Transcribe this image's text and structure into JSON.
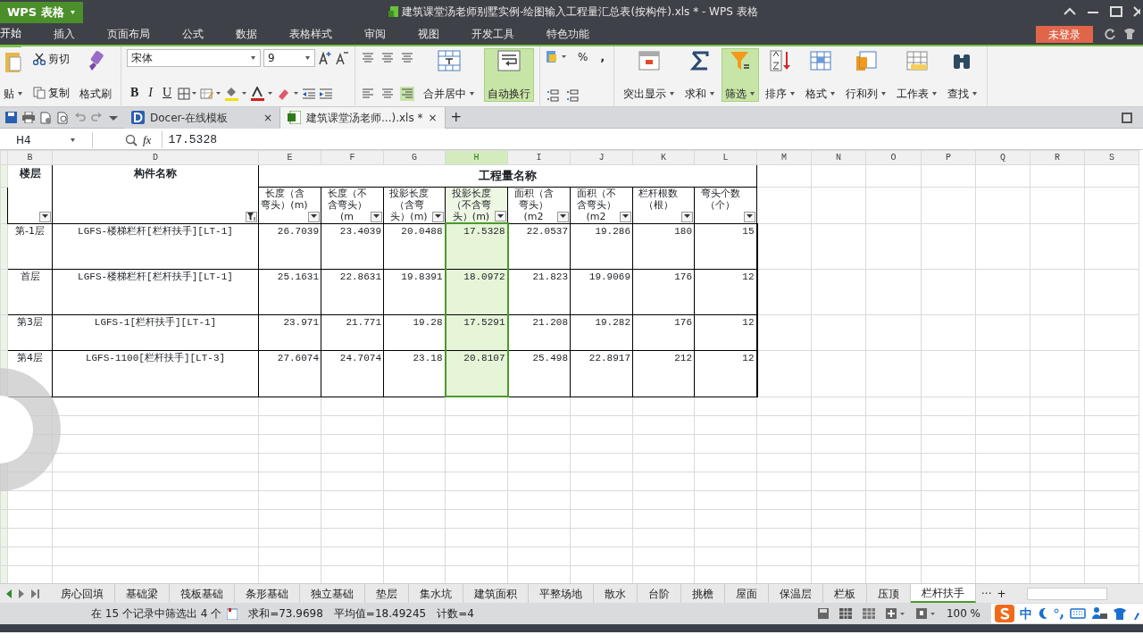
{
  "title_bar": {
    "app_menu": "WPS 表格",
    "title": "建筑课堂汤老师别墅实例-绘图输入工程量汇总表(按构件).xls * - WPS 表格"
  },
  "menu_tabs": [
    {
      "label": "开始",
      "selected": true
    },
    {
      "label": "插入",
      "selected": false
    },
    {
      "label": "页面布局",
      "selected": false
    },
    {
      "label": "公式",
      "selected": false
    },
    {
      "label": "数据",
      "selected": false
    },
    {
      "label": "表格样式",
      "selected": false
    },
    {
      "label": "审阅",
      "selected": false
    },
    {
      "label": "视图",
      "selected": false
    },
    {
      "label": "开发工具",
      "selected": false
    },
    {
      "label": "特色功能",
      "selected": false
    }
  ],
  "login_button": "未登录",
  "ribbon": {
    "paste": "贴",
    "cut": "剪切",
    "copy": "复制",
    "format_painter": "格式刷",
    "font": "宋体",
    "font_size": "9",
    "bold": "B",
    "italic": "I",
    "underline": "U",
    "merge": "合并居中",
    "wrap": {
      "label": "自动换行",
      "selected": true
    },
    "percent": "%",
    "comma": ",",
    "tools": [
      {
        "label": "突出显示",
        "selected": false
      },
      {
        "label": "求和",
        "selected": false
      },
      {
        "label": "筛选",
        "selected": true
      },
      {
        "label": "排序",
        "selected": false
      },
      {
        "label": "格式",
        "selected": false
      },
      {
        "label": "行和列",
        "selected": false
      },
      {
        "label": "工作表",
        "selected": false
      },
      {
        "label": "查找",
        "selected": false
      }
    ]
  },
  "doc_tabs": [
    {
      "label": "Docer-在线模板",
      "close": "×",
      "selected": false
    },
    {
      "label": "建筑课堂汤老师...).xls *",
      "close": "×",
      "selected": true
    }
  ],
  "new_tab": "+",
  "formula_bar": {
    "name_box": "H4",
    "fx": "fx",
    "value": "17.5328"
  },
  "columns": [
    {
      "label": "B",
      "selected": false
    },
    {
      "label": "D",
      "selected": false
    },
    {
      "label": "E",
      "selected": false
    },
    {
      "label": "F",
      "selected": false
    },
    {
      "label": "G",
      "selected": false
    },
    {
      "label": "H",
      "selected": true
    },
    {
      "label": "I",
      "selected": false
    },
    {
      "label": "J",
      "selected": false
    },
    {
      "label": "K",
      "selected": false
    },
    {
      "label": "L",
      "selected": false
    },
    {
      "label": "M",
      "selected": false
    },
    {
      "label": "N",
      "selected": false
    },
    {
      "label": "O",
      "selected": false
    },
    {
      "label": "P",
      "selected": false
    },
    {
      "label": "Q",
      "selected": false
    },
    {
      "label": "R",
      "selected": false
    },
    {
      "label": "S",
      "selected": false
    }
  ],
  "table": {
    "floor_header": "楼层",
    "name_header": "构件名称",
    "group_header": "工程量名称",
    "name_filter_active": true,
    "measures": [
      {
        "label": "长度（含弯头）(m)",
        "selected": false
      },
      {
        "label": "长度（不含弯头）(m",
        "selected": false
      },
      {
        "label": "投影长度（含弯头）(m)",
        "selected": false
      },
      {
        "label": "投影长度（不含弯头）(m)",
        "selected": true
      },
      {
        "label": "面积（含弯头）(m2",
        "selected": false
      },
      {
        "label": "面积（不含弯头）(m2",
        "selected": false
      },
      {
        "label": "栏杆根数（根）",
        "selected": false
      },
      {
        "label": "弯头个数（个）",
        "selected": false
      }
    ],
    "rows": [
      {
        "floor": "第-1层",
        "name": "LGFS-楼梯栏杆[栏杆扶手][LT-1]",
        "values": [
          "26.7039",
          "23.4039",
          "20.0488",
          "17.5328",
          "22.0537",
          "19.286",
          "180",
          "15"
        ]
      },
      {
        "floor": "首层",
        "name": "LGFS-楼梯栏杆[栏杆扶手][LT-1]",
        "values": [
          "25.1631",
          "22.8631",
          "19.8391",
          "18.0972",
          "21.823",
          "19.9069",
          "176",
          "12"
        ]
      },
      {
        "floor": "第3层",
        "name": "LGFS-1[栏杆扶手][LT-1]",
        "values": [
          "23.971",
          "21.771",
          "19.28",
          "17.5291",
          "21.208",
          "19.282",
          "176",
          "12"
        ]
      },
      {
        "floor": "第4层",
        "name": "LGFS-1100[栏杆扶手][LT-3]",
        "values": [
          "27.6074",
          "24.7074",
          "23.18",
          "20.8107",
          "25.498",
          "22.8917",
          "212",
          "12"
        ]
      }
    ]
  },
  "sheet_tabs": [
    {
      "label": "房心回填",
      "selected": false
    },
    {
      "label": "基础梁",
      "selected": false
    },
    {
      "label": "筏板基础",
      "selected": false
    },
    {
      "label": "条形基础",
      "selected": false
    },
    {
      "label": "独立基础",
      "selected": false
    },
    {
      "label": "垫层",
      "selected": false
    },
    {
      "label": "集水坑",
      "selected": false
    },
    {
      "label": "建筑面积",
      "selected": false
    },
    {
      "label": "平整场地",
      "selected": false
    },
    {
      "label": "散水",
      "selected": false
    },
    {
      "label": "台阶",
      "selected": false
    },
    {
      "label": "挑檐",
      "selected": false
    },
    {
      "label": "屋面",
      "selected": false
    },
    {
      "label": "保温层",
      "selected": false
    },
    {
      "label": "栏板",
      "selected": false
    },
    {
      "label": "压顶",
      "selected": false
    },
    {
      "label": "栏杆扶手",
      "selected": true
    }
  ],
  "sheet_more": "···",
  "sheet_add": "+",
  "status": {
    "filter": "在 15 个记录中筛选出 4 个",
    "sum": "求和=73.9698",
    "average": "平均值=18.49245",
    "count": "计数=4",
    "zoom": "100 %",
    "ime": "中"
  }
}
